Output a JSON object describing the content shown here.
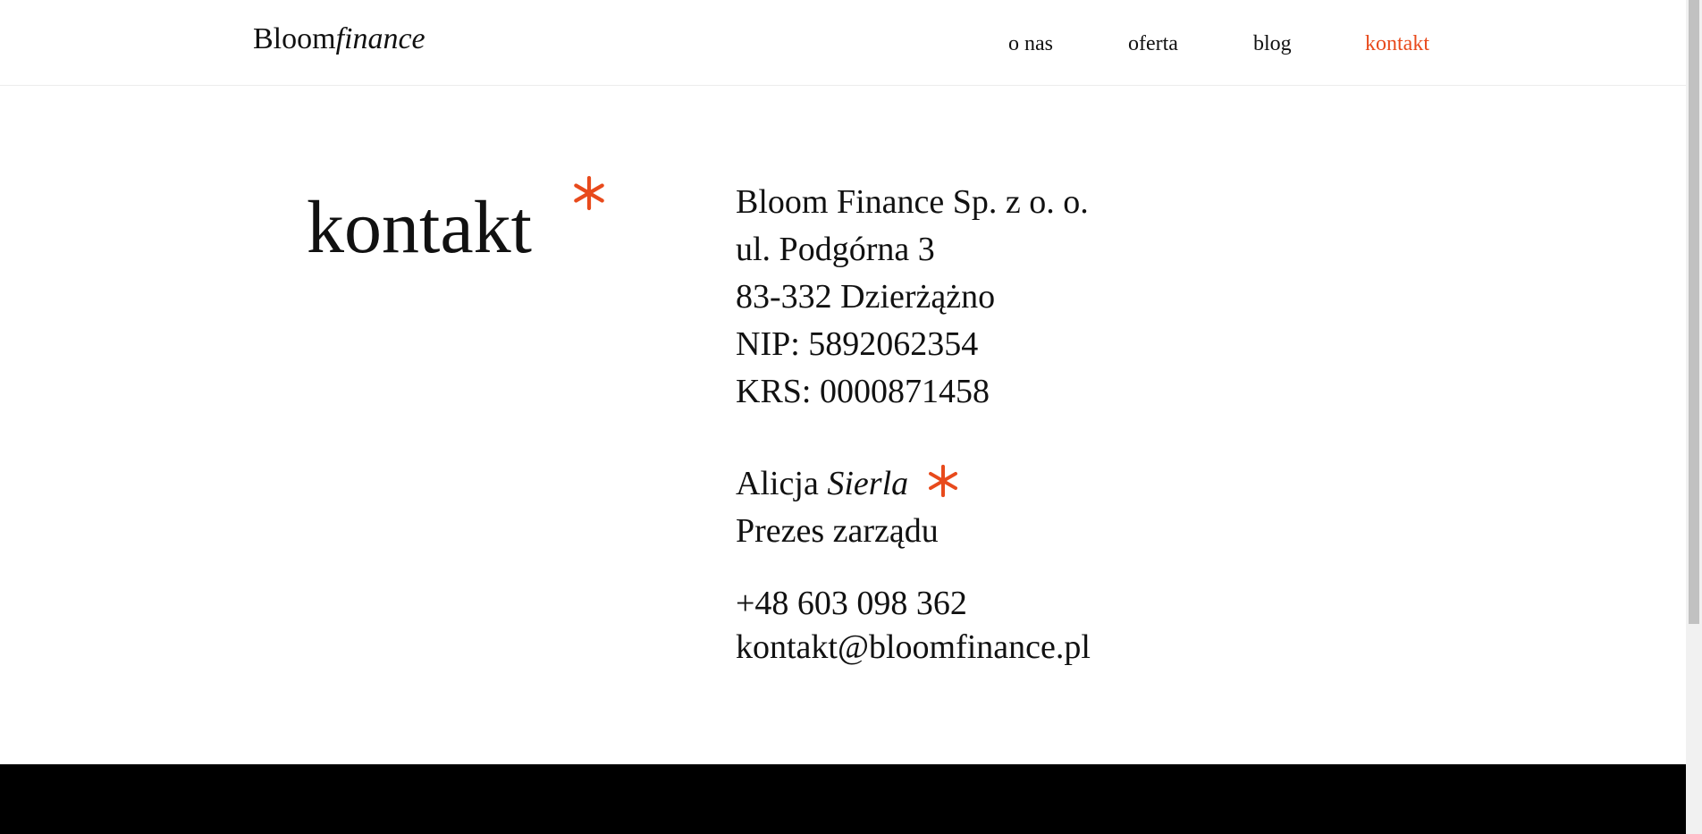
{
  "header": {
    "logo": {
      "regular": "Bloom",
      "italic": "finance"
    },
    "nav": [
      {
        "label": "o nas",
        "active": false
      },
      {
        "label": "oferta",
        "active": false
      },
      {
        "label": "blog",
        "active": false
      },
      {
        "label": "kontakt",
        "active": true
      }
    ]
  },
  "main": {
    "title": "kontakt",
    "company": {
      "name": "Bloom Finance Sp. z o. o.",
      "street": "ul. Podgórna 3",
      "city": "83-332 Dzierżążno",
      "nip": "NIP: 5892062354",
      "krs": "KRS: 0000871458"
    },
    "person": {
      "first_name": "Alicja",
      "last_name": "Sierla",
      "role": "Prezes zarządu"
    },
    "contact": {
      "phone": "+48 603 098 362",
      "email": "kontakt@bloomfinance.pl"
    }
  },
  "colors": {
    "accent": "#e84a1c",
    "text": "#111111",
    "footer": "#000000"
  },
  "icons": {
    "title_decoration": "asterisk-icon",
    "name_decoration": "asterisk-icon"
  }
}
